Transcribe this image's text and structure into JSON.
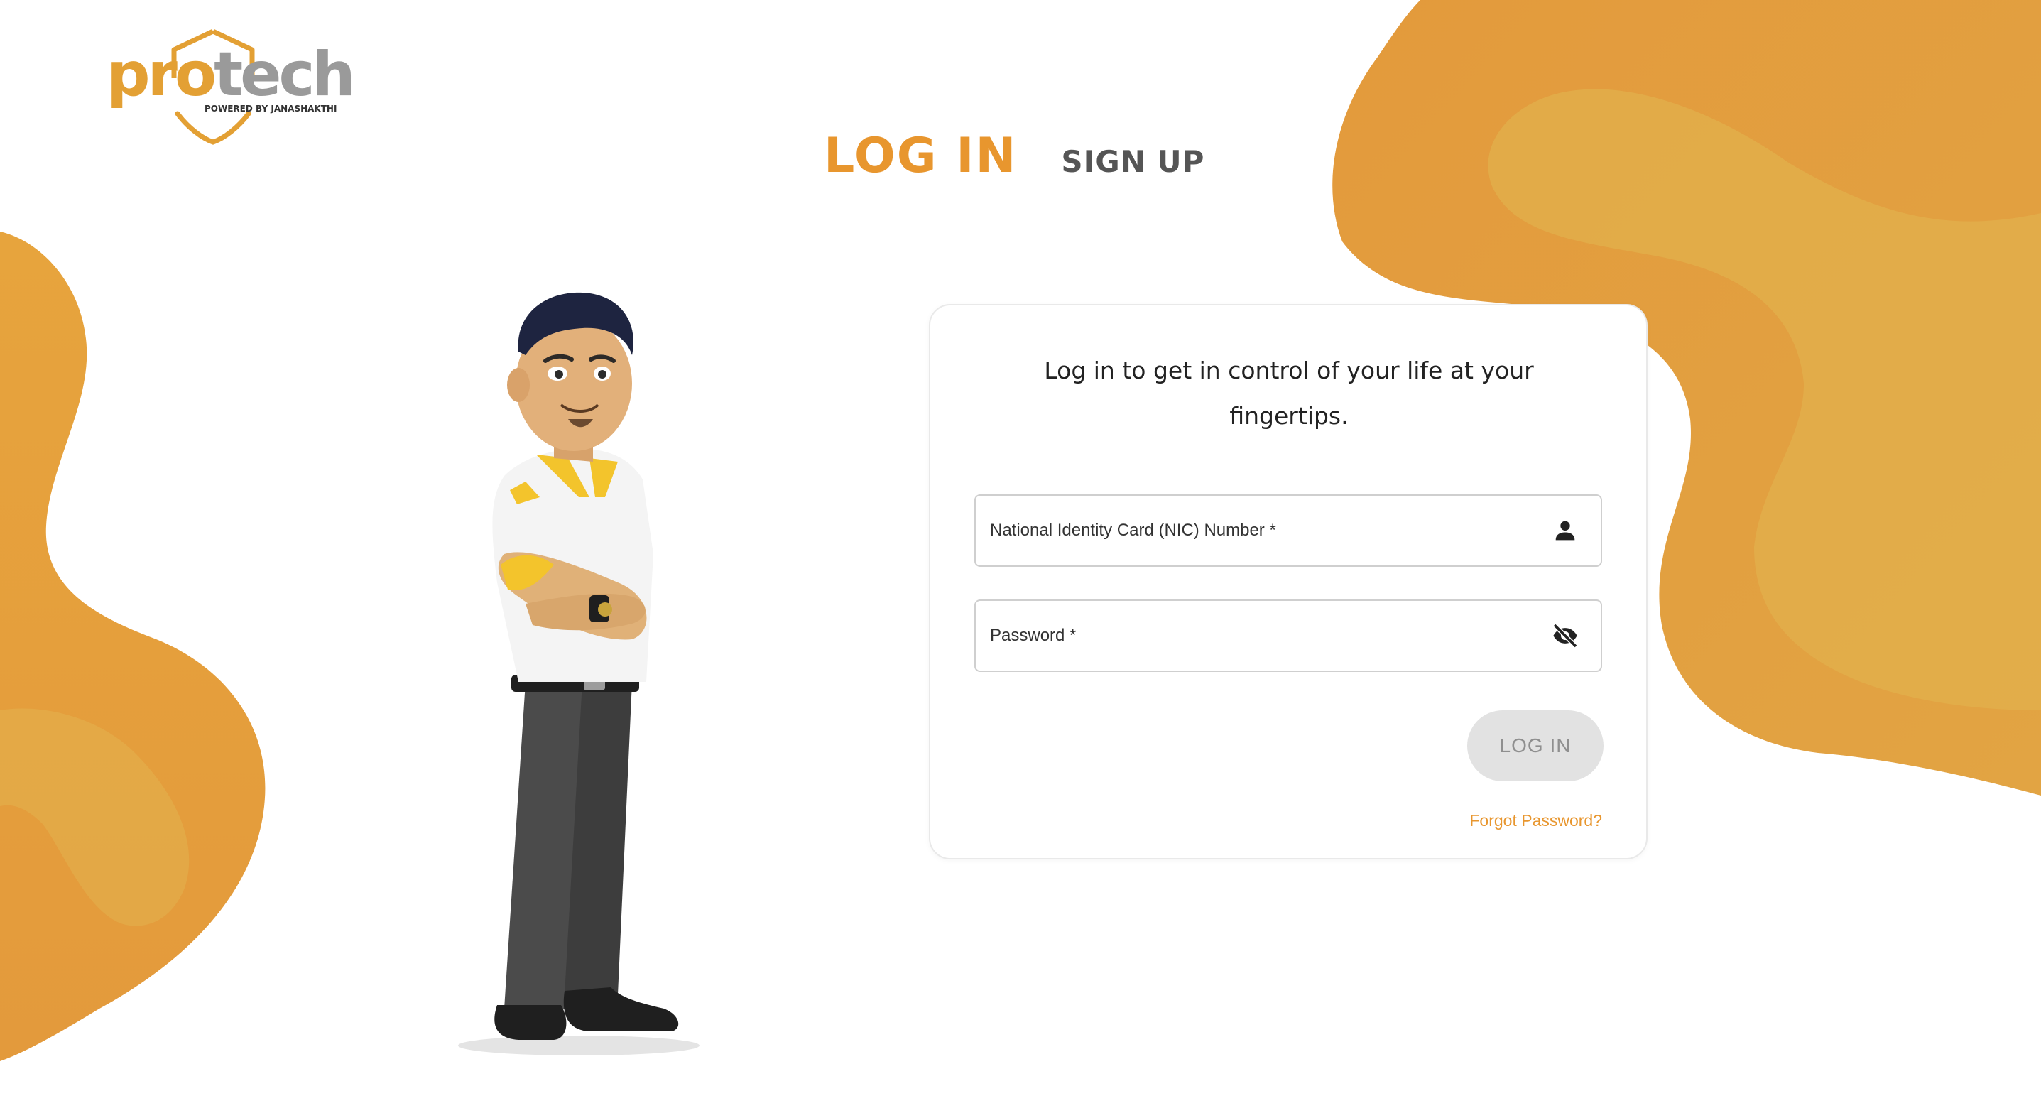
{
  "brand": {
    "logo_main_part1": "pro",
    "logo_main_part2": "tech",
    "logo_sub": "POWERED BY JANASHAKTHI"
  },
  "tabs": {
    "login": "LOG IN",
    "signup": "SIGN UP"
  },
  "card": {
    "intro": "Log in to get in control of your life at your fingertips.",
    "nic_label": "National Identity Card (NIC) Number *",
    "password_label": "Password *",
    "login_button": "LOG IN",
    "forgot_password": "Forgot Password?"
  },
  "icons": {
    "nic_field_icon": "person-icon",
    "password_field_icon": "eye-off-icon"
  },
  "colors": {
    "accent": "#e8962e",
    "blob_light": "#e2b04c",
    "blob_dark": "#e39a3c",
    "tab_inactive": "#555555",
    "button_disabled_bg": "#e2e2e2",
    "button_disabled_text": "#8f8f8f"
  }
}
